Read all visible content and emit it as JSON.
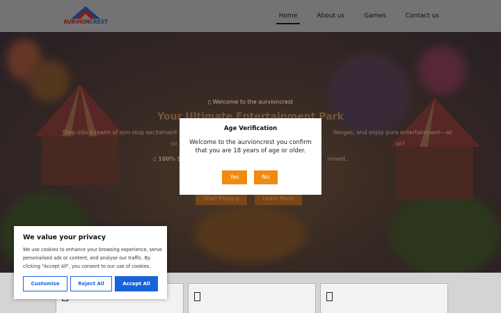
{
  "header": {
    "logo": {
      "text_main": "AURVION",
      "text_accent": "CREST"
    },
    "nav": [
      {
        "label": "Home",
        "active": true
      },
      {
        "label": "About us",
        "active": false
      },
      {
        "label": "Games",
        "active": false
      },
      {
        "label": "Contact us",
        "active": false
      }
    ]
  },
  "hero": {
    "tagline": "Welcome to the aurvioncrest",
    "title": "Your Ultimate Entertainment Park",
    "paragraph_1a": "Step into a realm of non-stop excitement",
    "paragraph_1b": "llenges, and enjoy pure entertainment—all",
    "paragraph_2a": "co",
    "paragraph_2b": "un!",
    "paragraph_3a": "100% S",
    "paragraph_3b": "nment.",
    "start_button": "Start Playing",
    "learn_button": "Learn More"
  },
  "age_modal": {
    "title": "Age Verification",
    "message": "Welcome to the aurvioncrest you confirm that you are 18 years of age or older.",
    "yes_label": "Yes",
    "no_label": "No"
  },
  "cookie_banner": {
    "title": "We value your privacy",
    "text": "We use cookies to enhance your browsing experience, serve personalised ads or content, and analyse our traffic. By clicking \"Accept All\", you consent to our use of cookies.",
    "customise_label": "Customise",
    "reject_label": "Reject All",
    "accept_label": "Accept All"
  },
  "colors": {
    "accent_orange": "#f08b10",
    "cookie_blue": "#1863dc",
    "header_bg": "#7a7a7a"
  }
}
